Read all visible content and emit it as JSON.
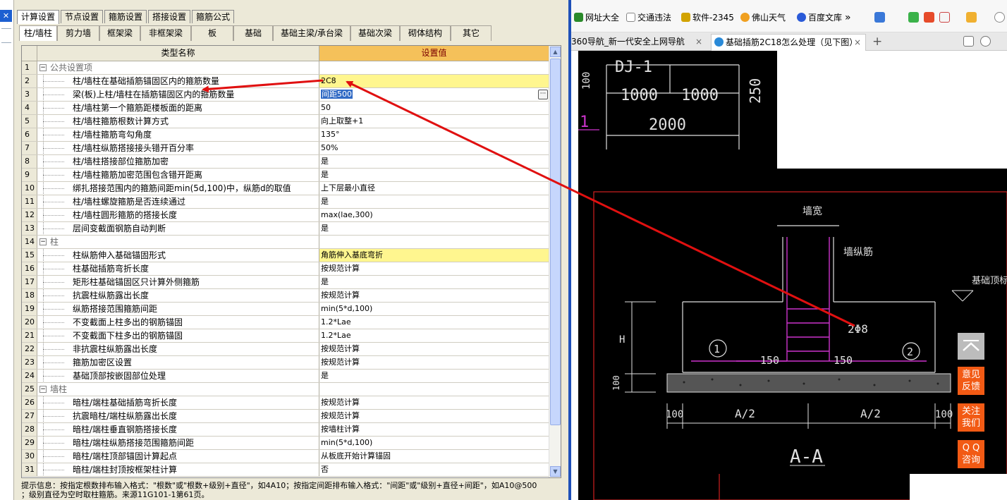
{
  "left_app": {
    "main_tabs": [
      {
        "label": "计算设置",
        "active": true
      },
      {
        "label": "节点设置",
        "active": false
      },
      {
        "label": "箍筋设置",
        "active": false
      },
      {
        "label": "搭接设置",
        "active": false
      },
      {
        "label": "箍筋公式",
        "active": false
      }
    ],
    "sub_tabs": [
      {
        "label": "柱/墙柱",
        "active": true
      },
      {
        "label": "剪力墙",
        "active": false
      },
      {
        "label": "框架梁",
        "active": false
      },
      {
        "label": "非框架梁",
        "active": false
      },
      {
        "label": "板",
        "active": false
      },
      {
        "label": "基础",
        "active": false
      },
      {
        "label": "基础主梁/承台梁",
        "active": false
      },
      {
        "label": "基础次梁",
        "active": false
      },
      {
        "label": "砌体结构",
        "active": false
      },
      {
        "label": "其它",
        "active": false
      }
    ],
    "grid": {
      "col_name": "类型名称",
      "col_value": "设置值",
      "rows": [
        {
          "num": "1",
          "name": "公共设置项",
          "value": "",
          "group": true,
          "highlight": false
        },
        {
          "num": "2",
          "name": "柱/墙柱在基础插筋锚固区内的箍筋数量",
          "value": "2C8",
          "group": false,
          "highlight": true
        },
        {
          "num": "3",
          "name": "梁(板)上柱/墙柱在插筋锚固区内的箍筋数量",
          "value": "间距500",
          "group": false,
          "highlight": false,
          "selected": true
        },
        {
          "num": "4",
          "name": "柱/墙柱第一个箍筋距楼板面的距离",
          "value": "50",
          "group": false,
          "highlight": false
        },
        {
          "num": "5",
          "name": "柱/墙柱箍筋根数计算方式",
          "value": "向上取整+1",
          "group": false,
          "highlight": false
        },
        {
          "num": "6",
          "name": "柱/墙柱箍筋弯勾角度",
          "value": "135°",
          "group": false,
          "highlight": false
        },
        {
          "num": "7",
          "name": "柱/墙柱纵筋搭接接头错开百分率",
          "value": "50%",
          "group": false,
          "highlight": false
        },
        {
          "num": "8",
          "name": "柱/墙柱搭接部位箍筋加密",
          "value": "是",
          "group": false,
          "highlight": false
        },
        {
          "num": "9",
          "name": "柱/墙柱箍筋加密范围包含错开距离",
          "value": "是",
          "group": false,
          "highlight": false
        },
        {
          "num": "10",
          "name": "绑扎搭接范围内的箍筋间距min(5d,100)中，纵筋d的取值",
          "value": "上下层最小直径",
          "group": false,
          "highlight": false
        },
        {
          "num": "11",
          "name": "柱/墙柱螺旋箍筋是否连续通过",
          "value": "是",
          "group": false,
          "highlight": false
        },
        {
          "num": "12",
          "name": "柱/墙柱圆形箍筋的搭接长度",
          "value": "max(lae,300)",
          "group": false,
          "highlight": false
        },
        {
          "num": "13",
          "name": "层间变截面钢筋自动判断",
          "value": "是",
          "group": false,
          "highlight": false
        },
        {
          "num": "14",
          "name": "柱",
          "value": "",
          "group": true,
          "highlight": false
        },
        {
          "num": "15",
          "name": "柱纵筋伸入基础锚固形式",
          "value": "角筋伸入基底弯折",
          "group": false,
          "highlight": true
        },
        {
          "num": "16",
          "name": "柱基础插筋弯折长度",
          "value": "按规范计算",
          "group": false,
          "highlight": false
        },
        {
          "num": "17",
          "name": "矩形柱基础锚固区只计算外侧箍筋",
          "value": "是",
          "group": false,
          "highlight": false
        },
        {
          "num": "18",
          "name": "抗震柱纵筋露出长度",
          "value": "按规范计算",
          "group": false,
          "highlight": false
        },
        {
          "num": "19",
          "name": "纵筋搭接范围箍筋间距",
          "value": "min(5*d,100)",
          "group": false,
          "highlight": false
        },
        {
          "num": "20",
          "name": "不变截面上柱多出的钢筋锚固",
          "value": "1.2*Lae",
          "group": false,
          "highlight": false
        },
        {
          "num": "21",
          "name": "不变截面下柱多出的钢筋锚固",
          "value": "1.2*Lae",
          "group": false,
          "highlight": false
        },
        {
          "num": "22",
          "name": "非抗震柱纵筋露出长度",
          "value": "按规范计算",
          "group": false,
          "highlight": false
        },
        {
          "num": "23",
          "name": "箍筋加密区设置",
          "value": "按规范计算",
          "group": false,
          "highlight": false
        },
        {
          "num": "24",
          "name": "基础顶部按嵌固部位处理",
          "value": "是",
          "group": false,
          "highlight": false
        },
        {
          "num": "25",
          "name": "墙柱",
          "value": "",
          "group": true,
          "highlight": false
        },
        {
          "num": "26",
          "name": "暗柱/端柱基础插筋弯折长度",
          "value": "按规范计算",
          "group": false,
          "highlight": false
        },
        {
          "num": "27",
          "name": "抗震暗柱/端柱纵筋露出长度",
          "value": "按规范计算",
          "group": false,
          "highlight": false
        },
        {
          "num": "28",
          "name": "暗柱/端柱垂直钢筋搭接长度",
          "value": "按墙柱计算",
          "group": false,
          "highlight": false
        },
        {
          "num": "29",
          "name": "暗柱/端柱纵筋搭接范围箍筋间距",
          "value": "min(5*d,100)",
          "group": false,
          "highlight": false
        },
        {
          "num": "30",
          "name": "暗柱/端柱顶部锚固计算起点",
          "value": "从板底开始计算锚固",
          "group": false,
          "highlight": false
        },
        {
          "num": "31",
          "name": "暗柱/端柱封顶按框架柱计算",
          "value": "否",
          "group": false,
          "highlight": false
        }
      ]
    },
    "hint_line1": "提示信息：按指定根数排布输入格式：\"根数\"或\"根数+级别+直径\"，如4A10；按指定间距排布输入格式：\"间距\"或\"级别+直径+间距\"，如A10@500",
    "hint_line2": "；级别直径为空时取柱箍筋。来源11G101-1第61页。",
    "ellipsis": "···"
  },
  "browser": {
    "bookmarks": [
      {
        "label": "网址大全",
        "color": "#2a8a2a"
      },
      {
        "label": "交通违法",
        "color": "#ffffff"
      },
      {
        "label": "软件-2345",
        "color": "#d2a300"
      },
      {
        "label": "佛山天气",
        "color": "#f0a020"
      },
      {
        "label": "百度文库",
        "color": "#2a5ad8"
      }
    ],
    "bookmarks_more": "»",
    "tabs": [
      {
        "label": "360导航_新一代安全上网导航",
        "active": false
      },
      {
        "label": "基础插筋2C18怎么处理（见下图）",
        "active": true
      }
    ],
    "tab_close": "×",
    "new_tab": "+",
    "side_buttons": [
      {
        "label_top": "意见",
        "label_bottom": "反馈"
      },
      {
        "label_top": "关注",
        "label_bottom": "我们"
      },
      {
        "label_top": "Q Q",
        "label_bottom": "咨询"
      }
    ],
    "drawing": {
      "title_code": "DJ-1",
      "dim_1000_a": "1000",
      "dim_1000_b": "1000",
      "dim_2000": "2000",
      "dim_250": "250",
      "dim_100_side": "100",
      "marker_1": "1",
      "label_qiangkuan": "墙宽",
      "label_qiangzongjin": "墙纵筋",
      "label_jichudingbiao": "基础顶标",
      "label_h": "H",
      "label_100_left": "100",
      "label_stirrup": "2Φ8",
      "label_150_left": "150",
      "label_150_right": "150",
      "circle_1": "1",
      "circle_2": "2",
      "label_a2_left": "A/2",
      "label_a2_right": "A/2",
      "label_100_bottom_left": "100",
      "label_100_bottom_right": "100",
      "section_title": "A-A"
    }
  },
  "colors": {
    "divider": "#1e50b8",
    "highlight_row": "#fff68f",
    "value_header": "#f5c15a",
    "annotation_arrow": "#e01010",
    "side_button": "#f25a14",
    "cad_background": "#000000"
  }
}
